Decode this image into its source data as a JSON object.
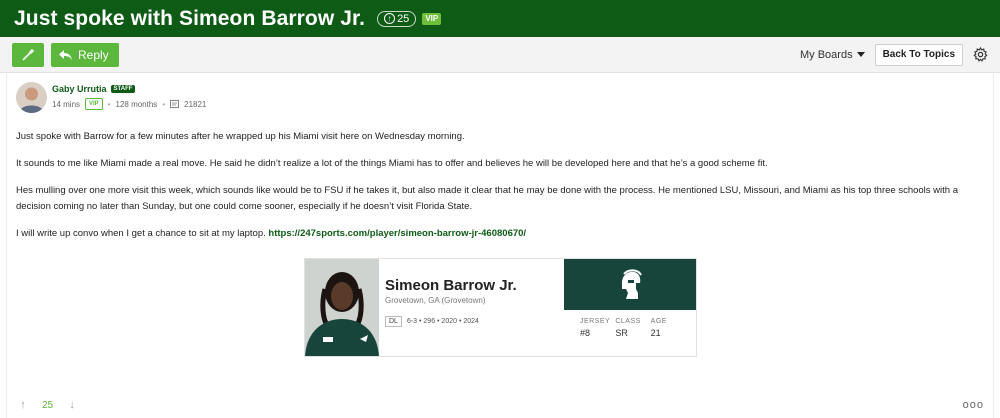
{
  "thread": {
    "title": "Just spoke with Simeon Barrow Jr.",
    "votes": "25",
    "badge": "VIP"
  },
  "toolbar": {
    "reply_label": "Reply",
    "my_boards_label": "My Boards",
    "back_label": "Back To Topics"
  },
  "post": {
    "author": "Gaby Urrutia",
    "author_badge": "STAFF",
    "time": "14 mins",
    "vip": "VIP",
    "tenure": "128 months",
    "posts_count": "21821",
    "paragraphs": [
      "Just spoke with Barrow for a few minutes after he wrapped up his Miami visit here on Wednesday morning.",
      "It sounds to me like Miami made a real move. He said he didn’t realize a lot of the things Miami has to offer and believes he will be developed here and that he’s a good scheme fit.",
      "Hes mulling over one more visit this week, which sounds like would be to FSU if he takes it, but also made it clear that he may be done with the process. He mentioned LSU, Missouri, and Miami as his top three schools with a decision coming no later than Sunday, but one could come sooner, especially if he doesn’t visit Florida State."
    ],
    "last_paragraph_text": "I will write up convo when I get a chance to sit at my laptop.",
    "link": "https://247sports.com/player/simeon-barrow-jr-46080670/",
    "score": "25"
  },
  "player_card": {
    "name": "Simeon Barrow Jr.",
    "location": "Grovetown, GA (Grovetown)",
    "position": "DL",
    "stats": "6-3 • 296 • 2020 • 2024",
    "attrs": [
      {
        "label": "JERSEY",
        "value": "#8"
      },
      {
        "label": "CLASS",
        "value": "SR"
      },
      {
        "label": "AGE",
        "value": "21"
      }
    ]
  },
  "colors": {
    "brand_green": "#0e5b16",
    "button_green": "#5cb73d",
    "spartan_green": "#18453b"
  }
}
